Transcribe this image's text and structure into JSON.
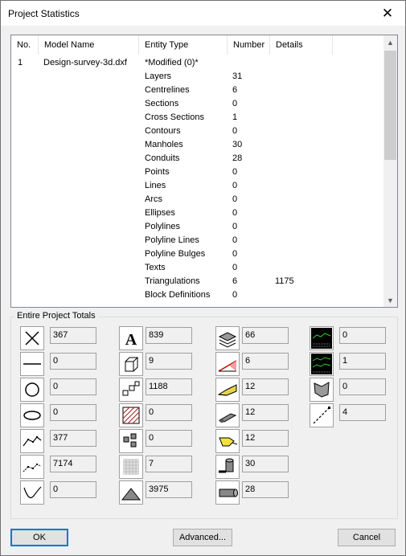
{
  "window": {
    "title": "Project Statistics",
    "close_glyph": "✕"
  },
  "table": {
    "headers": {
      "no": "No.",
      "model": "Model Name",
      "type": "Entity Type",
      "number": "Number",
      "details": "Details"
    },
    "rows": [
      {
        "no": "1",
        "model": "Design-survey-3d.dxf",
        "type": "*Modified (0)*",
        "number": "",
        "details": ""
      },
      {
        "no": "",
        "model": "",
        "type": "Layers",
        "number": "31",
        "details": ""
      },
      {
        "no": "",
        "model": "",
        "type": "Centrelines",
        "number": "6",
        "details": ""
      },
      {
        "no": "",
        "model": "",
        "type": "Sections",
        "number": "0",
        "details": ""
      },
      {
        "no": "",
        "model": "",
        "type": "Cross Sections",
        "number": "1",
        "details": ""
      },
      {
        "no": "",
        "model": "",
        "type": "Contours",
        "number": "0",
        "details": ""
      },
      {
        "no": "",
        "model": "",
        "type": "Manholes",
        "number": "30",
        "details": ""
      },
      {
        "no": "",
        "model": "",
        "type": "Conduits",
        "number": "28",
        "details": ""
      },
      {
        "no": "",
        "model": "",
        "type": "Points",
        "number": "0",
        "details": ""
      },
      {
        "no": "",
        "model": "",
        "type": "Lines",
        "number": "0",
        "details": ""
      },
      {
        "no": "",
        "model": "",
        "type": "Arcs",
        "number": "0",
        "details": ""
      },
      {
        "no": "",
        "model": "",
        "type": "Ellipses",
        "number": "0",
        "details": ""
      },
      {
        "no": "",
        "model": "",
        "type": "Polylines",
        "number": "0",
        "details": ""
      },
      {
        "no": "",
        "model": "",
        "type": "Polyline Lines",
        "number": "0",
        "details": ""
      },
      {
        "no": "",
        "model": "",
        "type": "Polyline Bulges",
        "number": "0",
        "details": ""
      },
      {
        "no": "",
        "model": "",
        "type": "Texts",
        "number": "0",
        "details": ""
      },
      {
        "no": "",
        "model": "",
        "type": "Triangulations",
        "number": "6",
        "details": "1175"
      },
      {
        "no": "",
        "model": "",
        "type": "Block Definitions",
        "number": "0",
        "details": ""
      }
    ]
  },
  "totals": {
    "label": "Entire Project Totals",
    "col1": [
      {
        "icon": "points-x-icon",
        "value": "367"
      },
      {
        "icon": "line-icon",
        "value": "0"
      },
      {
        "icon": "circle-icon",
        "value": "0"
      },
      {
        "icon": "ellipse-icon",
        "value": "0"
      },
      {
        "icon": "polyline-icon",
        "value": "377"
      },
      {
        "icon": "polyline-vertices-icon",
        "value": "7174"
      },
      {
        "icon": "curve-icon",
        "value": "0"
      }
    ],
    "col2": [
      {
        "icon": "text-icon",
        "value": "839"
      },
      {
        "icon": "block-definition-icon",
        "value": "9"
      },
      {
        "icon": "block-insert-icon",
        "value": "1188"
      },
      {
        "icon": "hatch-icon",
        "value": "0"
      },
      {
        "icon": "symbol-array-icon",
        "value": "0"
      },
      {
        "icon": "dot-pattern-icon",
        "value": "7"
      },
      {
        "icon": "triangle-icon",
        "value": "3975"
      }
    ],
    "col3": [
      {
        "icon": "layers-icon",
        "value": "66"
      },
      {
        "icon": "section-icon",
        "value": "6"
      },
      {
        "icon": "surface-yellow-icon",
        "value": "12"
      },
      {
        "icon": "conduit-icon",
        "value": "12"
      },
      {
        "icon": "hand-yellow-icon",
        "value": "12"
      },
      {
        "icon": "manhole-icon",
        "value": "30"
      },
      {
        "icon": "pipe-icon",
        "value": "28"
      }
    ],
    "col4": [
      {
        "icon": "profile-graph-icon",
        "value": "0"
      },
      {
        "icon": "cross-section-graph-icon",
        "value": "1"
      },
      {
        "icon": "boundary-icon",
        "value": "0"
      },
      {
        "icon": "dashed-line-icon",
        "value": "4"
      }
    ]
  },
  "buttons": {
    "ok": "OK",
    "advanced": "Advanced...",
    "cancel": "Cancel"
  },
  "scroll_arrows": {
    "up": "▲",
    "down": "▼"
  }
}
